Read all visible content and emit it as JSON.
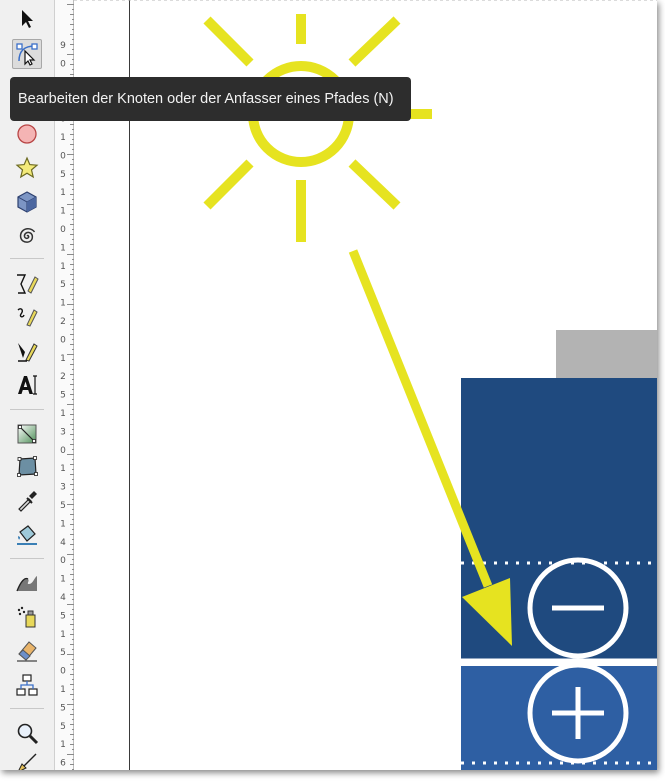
{
  "toolbox": {
    "tools": [
      {
        "name": "selector-tool",
        "icon": "arrow-icon",
        "active": false
      },
      {
        "name": "node-tool",
        "icon": "node-edit-icon",
        "active": true
      },
      {
        "name": "rectangle-tool",
        "icon": "rectangle-icon",
        "active": false
      },
      {
        "name": "circle-tool",
        "icon": "circle-icon",
        "active": false
      },
      {
        "name": "star-tool",
        "icon": "star-icon",
        "active": false
      },
      {
        "name": "3d-box-tool",
        "icon": "box-3d-icon",
        "active": false
      },
      {
        "name": "spiral-tool",
        "icon": "spiral-icon",
        "active": false
      },
      {
        "name": "pencil-tool",
        "icon": "pencil-icon",
        "active": false
      },
      {
        "name": "bezier-tool",
        "icon": "pen-icon",
        "active": false
      },
      {
        "name": "calligraphy-tool",
        "icon": "calligraphy-icon",
        "active": false
      },
      {
        "name": "text-tool",
        "icon": "text-icon",
        "active": false
      },
      {
        "name": "gradient-tool",
        "icon": "gradient-icon",
        "active": false
      },
      {
        "name": "mesh-tool",
        "icon": "mesh-icon",
        "active": false
      },
      {
        "name": "dropper-tool",
        "icon": "dropper-icon",
        "active": false
      },
      {
        "name": "paint-bucket-tool",
        "icon": "paint-bucket-icon",
        "active": false
      },
      {
        "name": "tweak-tool",
        "icon": "tweak-icon",
        "active": false
      },
      {
        "name": "spray-tool",
        "icon": "spray-icon",
        "active": false
      },
      {
        "name": "eraser-tool",
        "icon": "eraser-icon",
        "active": false
      },
      {
        "name": "connector-tool",
        "icon": "connector-icon",
        "active": false
      },
      {
        "name": "zoom-tool",
        "icon": "zoom-icon",
        "active": false
      },
      {
        "name": "measure-tool",
        "icon": "measure-icon",
        "active": false
      }
    ]
  },
  "tooltip": {
    "text": "Bearbeiten der Knoten oder der Anfasser eines Pfades (N)"
  },
  "ruler": {
    "labels": [
      "9",
      "0",
      "1",
      "0",
      "0",
      "1",
      "0",
      "5",
      "1",
      "1",
      "0",
      "1",
      "1",
      "5",
      "1",
      "2",
      "0",
      "1",
      "2",
      "5",
      "1",
      "3",
      "0",
      "1",
      "3",
      "5",
      "1",
      "4",
      "0",
      "1",
      "4",
      "5",
      "1",
      "5",
      "0",
      "1",
      "5",
      "5",
      "1",
      "6"
    ]
  },
  "colors": {
    "sun_yellow": "#e6e320",
    "battery_dark_blue": "#1f4a7f",
    "battery_blue": "#2e5fa3",
    "battery_cap_gray": "#b3b3b3",
    "tooltip_bg": "#2d2d2d"
  }
}
